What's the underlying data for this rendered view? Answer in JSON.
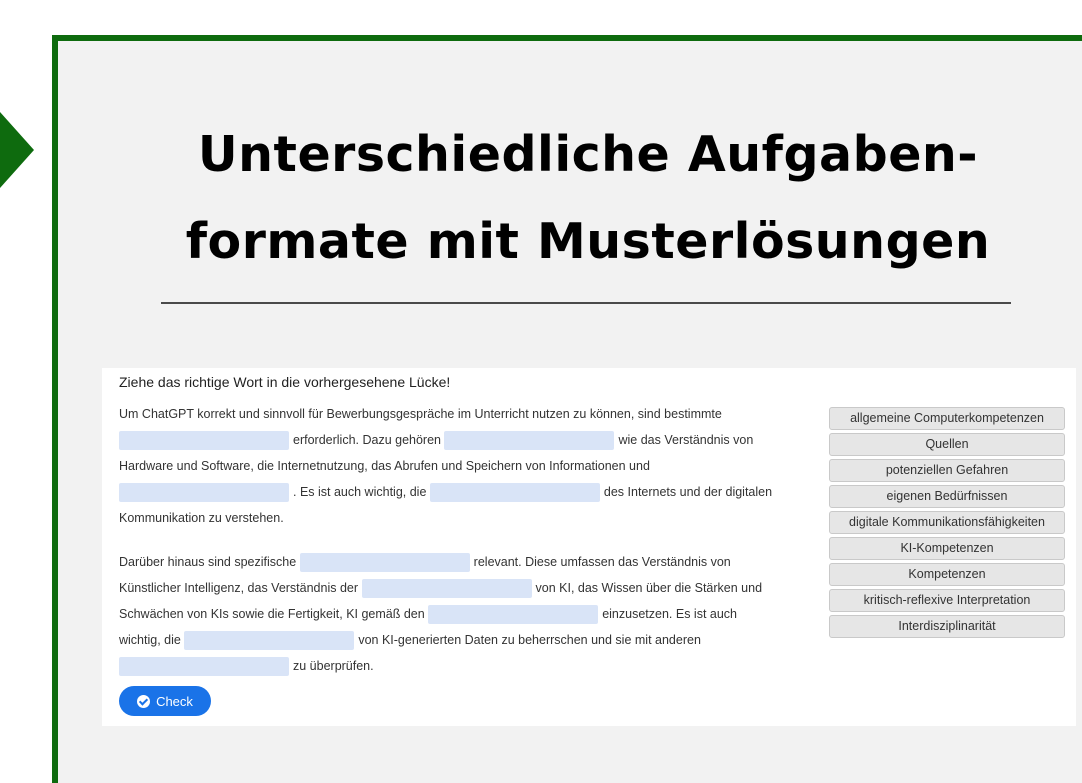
{
  "slide": {
    "title_line1": "Unterschiedliche Aufgaben-",
    "title_line2": "formate mit Musterlösungen",
    "accent_color": "#0e6b0e"
  },
  "exercise": {
    "instruction": "Ziehe das richtige Wort in die vorhergesehene Lücke!",
    "paragraph1": {
      "l1_a": "Um ChatGPT korrekt und sinnvoll für Bewerbungsgespräche im Unterricht nutzen zu können, sind bestimmte",
      "l2_a": "erforderlich. Dazu gehören",
      "l2_b": "wie das Verständnis von",
      "l3_a": "Hardware und Software, die Internetnutzung, das Abrufen und Speichern von Informationen und",
      "l4_a": ". Es ist auch wichtig, die",
      "l4_b": "des Internets und der digitalen",
      "l5_a": "Kommunikation zu verstehen."
    },
    "paragraph2": {
      "l1_a": "Darüber hinaus sind spezifische",
      "l1_b": "relevant. Diese umfassen das Verständnis von",
      "l2_a": "Künstlicher Intelligenz, das Verständnis der",
      "l2_b": "von KI, das Wissen über die Stärken und",
      "l3_a": "Schwächen von KIs sowie die Fertigkeit, KI gemäß den",
      "l3_b": "einzusetzen. Es ist auch",
      "l4_a": "wichtig, die",
      "l4_b": "von KI-generierten Daten zu beherrschen und sie mit anderen",
      "l5_a": "zu überprüfen."
    },
    "options": [
      "allgemeine Computerkompetenzen",
      "Quellen",
      "potenziellen Gefahren",
      "eigenen Bedürfnissen",
      "digitale Kommunikationsfähigkeiten",
      "KI-Kompetenzen",
      "Kompetenzen",
      "kritisch-reflexive Interpretation",
      "Interdisziplinarität"
    ],
    "check_label": "Check",
    "check_icon": "check-circle-icon",
    "button_color": "#1a73e8",
    "gap_color": "#d9e4f7"
  }
}
